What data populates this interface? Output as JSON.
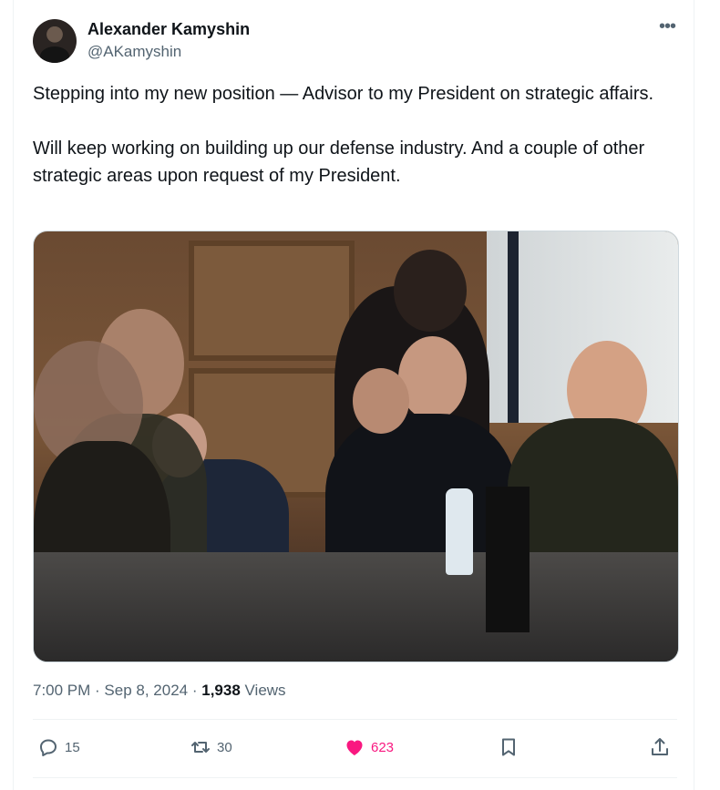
{
  "tweet": {
    "author_name": "Alexander Kamyshin",
    "author_handle": "@AKamyshin",
    "paragraph1": "Stepping into my new position — Advisor to my President on strategic affairs.",
    "paragraph2": "Will keep working on building up our defense industry. And a couple of other strategic areas upon request of my President.",
    "more_icon": "more-dots-icon"
  },
  "meta": {
    "time": "7:00 PM",
    "separator": " · ",
    "date": "Sep 8, 2024",
    "views_count": "1,938",
    "views_label": " Views"
  },
  "actions": {
    "replies": "15",
    "reposts": "30",
    "likes": "623",
    "like_color": "#f91880"
  }
}
